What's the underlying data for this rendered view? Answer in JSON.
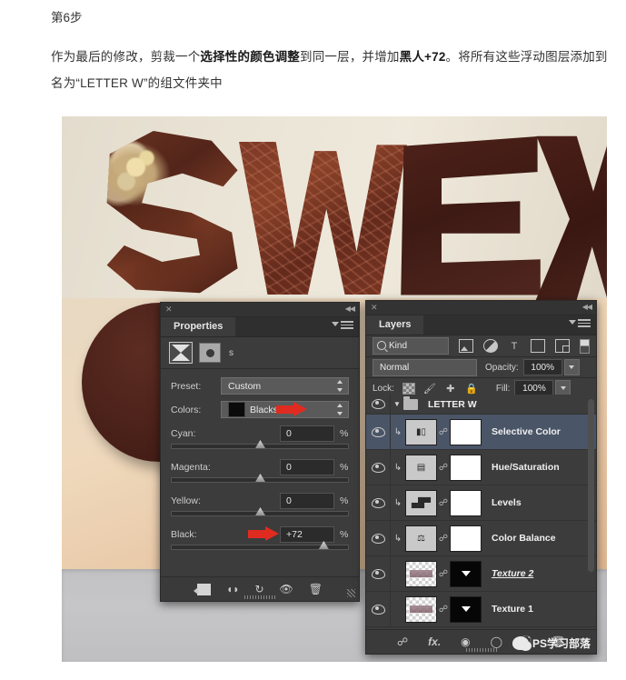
{
  "article": {
    "step_title": "第6步",
    "paragraph_parts": [
      {
        "text": "作为最后的修改，剪裁一个",
        "bold": false
      },
      {
        "text": "选择性的颜色调整",
        "bold": true
      },
      {
        "text": "到同一层，并增加",
        "bold": false
      },
      {
        "text": "黑人+72",
        "bold": true
      },
      {
        "text": "。将所有这些浮动图层添加到名为“LETTER W”的组文件夹中",
        "bold": false
      }
    ]
  },
  "artwork": {
    "letters": [
      "S",
      "W",
      "E",
      "X",
      "O"
    ],
    "description": "chocolate-3d-letters"
  },
  "properties_panel": {
    "title": "Properties",
    "close_icon": "close-icon",
    "collapse_icon": "collapse-icon",
    "menu_icon": "panel-menu-icon",
    "header_label": "s",
    "adjustment_icon": "selective-color-icon",
    "mask_icon": "layer-mask-icon",
    "preset": {
      "label": "Preset:",
      "value": "Custom"
    },
    "colors": {
      "label": "Colors:",
      "value": "Blacks",
      "swatch": "#0b0b0b"
    },
    "sliders": [
      {
        "label": "Cyan:",
        "value": "0",
        "unit": "%",
        "knob_pct": 50
      },
      {
        "label": "Magenta:",
        "value": "0",
        "unit": "%",
        "knob_pct": 50
      },
      {
        "label": "Yellow:",
        "value": "0",
        "unit": "%",
        "knob_pct": 50
      },
      {
        "label": "Black:",
        "value": "+72",
        "unit": "%",
        "knob_pct": 86
      }
    ],
    "footer_icons": [
      "clip-to-layer-icon",
      "view-previous-state-icon",
      "reset-icon",
      "toggle-visibility-icon",
      "delete-icon"
    ]
  },
  "layers_panel": {
    "title": "Layers",
    "close_icon": "close-icon",
    "collapse_icon": "collapse-icon",
    "menu_icon": "panel-menu-icon",
    "filter": {
      "kind_label": "Kind",
      "icons": [
        "filter-image-icon",
        "filter-adjustment-icon",
        "filter-type-icon",
        "filter-shape-icon",
        "filter-smart-object-icon",
        "filter-toggle-icon"
      ]
    },
    "blend_mode": "Normal",
    "opacity": {
      "label": "Opacity:",
      "value": "100%"
    },
    "lock": {
      "label": "Lock:",
      "icons": [
        "lock-transparent-icon",
        "lock-image-icon",
        "lock-position-icon",
        "lock-all-icon"
      ]
    },
    "fill": {
      "label": "Fill:",
      "value": "100%"
    },
    "rows": [
      {
        "name": "LETTER W",
        "type": "group",
        "visible": true,
        "selected": false
      },
      {
        "name": "Selective Color",
        "type": "adjustment",
        "visible": true,
        "selected": true,
        "clipped": true,
        "thumb_glyph": "selective-color-icon",
        "mask": "white"
      },
      {
        "name": "Hue/Saturation",
        "type": "adjustment",
        "visible": true,
        "selected": false,
        "clipped": true,
        "thumb_glyph": "hue-saturation-icon",
        "mask": "white"
      },
      {
        "name": "Levels",
        "type": "adjustment",
        "visible": true,
        "selected": false,
        "clipped": true,
        "thumb_glyph": "levels-icon",
        "mask": "white"
      },
      {
        "name": "Color Balance",
        "type": "adjustment",
        "visible": true,
        "selected": false,
        "clipped": true,
        "thumb_glyph": "color-balance-icon",
        "mask": "white"
      },
      {
        "name": "Texture 2",
        "type": "pixel",
        "visible": true,
        "selected": false,
        "clipped": false,
        "mask": "black",
        "underline": true
      },
      {
        "name": "Texture 1",
        "type": "pixel",
        "visible": true,
        "selected": false,
        "clipped": false,
        "mask": "black",
        "underline": false
      }
    ],
    "footer_icons": [
      "link-layers-icon",
      "layer-style-fx-icon",
      "add-mask-icon",
      "new-group-icon",
      "new-layer-icon",
      "delete-layer-icon"
    ]
  },
  "watermark": {
    "icon": "wechat-icon",
    "text": "PS学习部落"
  },
  "colors": {
    "panel_bg": "#3c3c3c",
    "panel_selected": "#4a5567",
    "annotation_red": "#e02b20",
    "text": "#333333"
  }
}
